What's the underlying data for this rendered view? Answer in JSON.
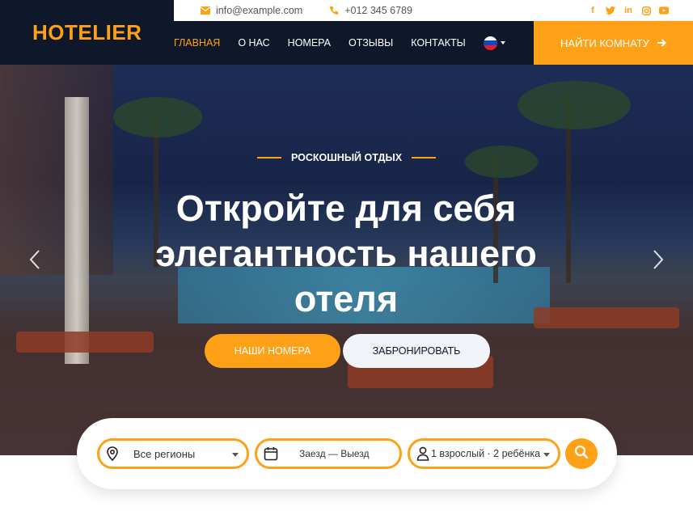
{
  "brand": "HOTELIER",
  "topbar": {
    "email": "info@example.com",
    "phone": "+012 345 6789",
    "socials": [
      "facebook-icon",
      "twitter-icon",
      "linkedin-icon",
      "instagram-icon",
      "youtube-icon"
    ]
  },
  "nav": {
    "items": [
      "ГЛАВНАЯ",
      "О НАС",
      "НОМЕРА",
      "ОТЗЫВЫ",
      "КОНТАКТЫ"
    ],
    "active_index": 0,
    "language": "ru-flag-icon",
    "cta": "НАЙТИ КОМНАТУ"
  },
  "hero": {
    "eyebrow": "РОСКОШНЫЙ ОТДЫХ",
    "headline": "Откройте для себя элегантность нашего отеля",
    "primary_button": "НАШИ НОМЕРА",
    "secondary_button": "ЗАБРОНИРОВАТЬ"
  },
  "search": {
    "region": "Все регионы",
    "dates": "Заезд — Выезд",
    "guests": "1 взрослый · 2 ребёнка"
  },
  "colors": {
    "accent": "#fea116",
    "dark": "#0f172b"
  }
}
